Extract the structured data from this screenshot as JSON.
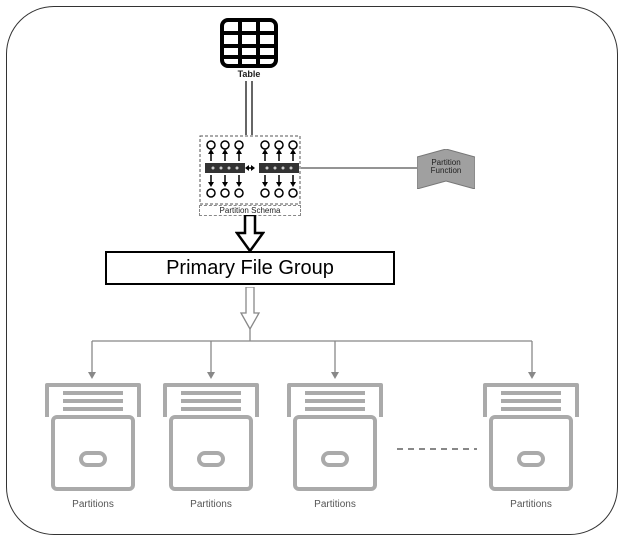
{
  "labels": {
    "table": "Table",
    "partition_schema": "Partition Schema",
    "partition_function_line1": "Partition",
    "partition_function_line2": "Function",
    "primary_file_group": "Primary File Group",
    "partition": "Partitions"
  }
}
